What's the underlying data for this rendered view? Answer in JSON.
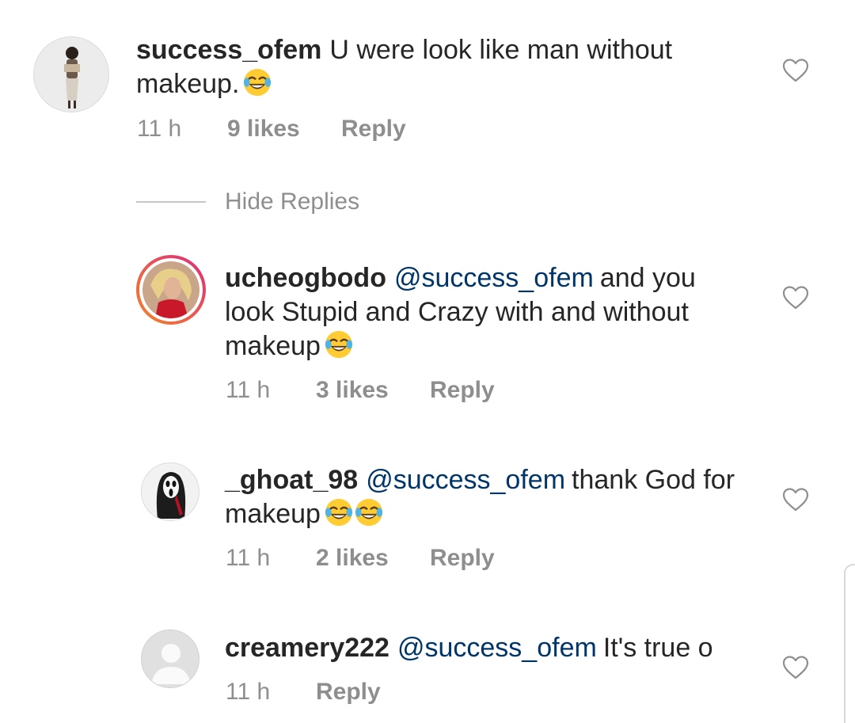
{
  "comments": [
    {
      "username": "success_ofem",
      "mention": "",
      "text": "U were look like man without makeup.",
      "emojis": 1,
      "time": "11 h",
      "likes": "9 likes",
      "reply": "Reply"
    },
    {
      "username": "ucheogbodo",
      "mention": "@success_ofem",
      "text": "and you look Stupid and Crazy with and without makeup",
      "emojis": 1,
      "time": "11 h",
      "likes": "3 likes",
      "reply": "Reply"
    },
    {
      "username": "_ghoat_98",
      "mention": "@success_ofem",
      "text": "thank God for makeup",
      "emojis": 2,
      "time": "11 h",
      "likes": "2 likes",
      "reply": "Reply"
    },
    {
      "username": "creamery222",
      "mention": "@success_ofem",
      "text": "It's true o",
      "emojis": 0,
      "time": "11 h",
      "likes": "",
      "reply": "Reply"
    }
  ],
  "hide_replies": "Hide Replies",
  "icons": {
    "like": "heart-outline-icon",
    "emoji": "face-with-tears-of-joy-emoji"
  },
  "colors": {
    "text": "#262626",
    "mention": "#003569",
    "meta": "#8e8e8e",
    "story_ring_start": "#f58529",
    "story_ring_end": "#dd2a7b"
  }
}
